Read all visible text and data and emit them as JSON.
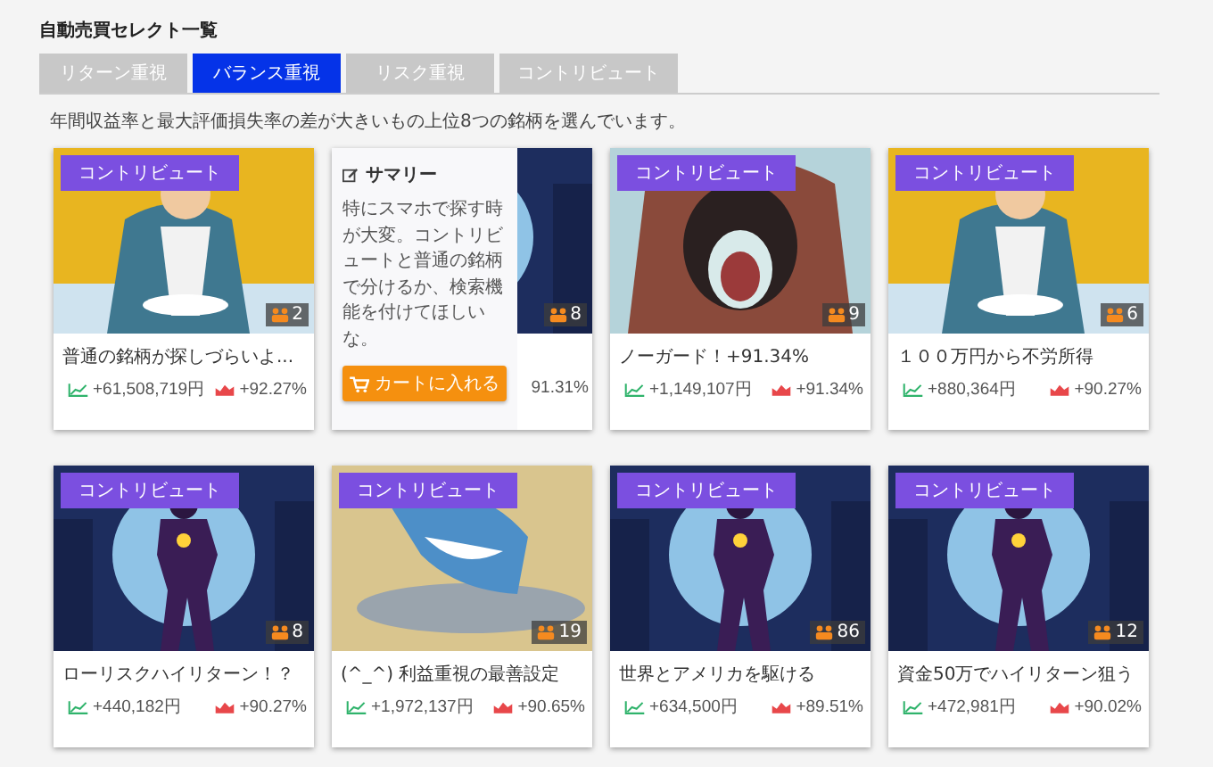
{
  "page_title": "自動売買セレクト一覧",
  "tabs": [
    {
      "label": "リターン重視",
      "selected": false
    },
    {
      "label": "バランス重視",
      "selected": true
    },
    {
      "label": "リスク重視",
      "selected": false
    },
    {
      "label": "コントリビュート",
      "selected": false
    }
  ],
  "description": "年間収益率と最大評価損失率の差が大きいもの上位8つの銘柄を選んでいます。",
  "cards": [
    {
      "kind": "diner",
      "badge": "コントリビュート",
      "count": "2",
      "title": "普通の銘柄が探しづらいよ...",
      "profit": "+61,508,719円",
      "rate": "+92.27%"
    },
    {
      "kind": "hero",
      "count": "8",
      "rate": "91.31%",
      "popup": {
        "heading": "サマリー",
        "text": "特にスマホで探す時が大変。コントリビュートと普通の銘柄で分けるか、検索機能を付けてほしいな。",
        "button": "カートに入れる"
      }
    },
    {
      "kind": "gorilla",
      "badge": "コントリビュート",
      "count": "9",
      "title": "ノーガード！+91.34%",
      "profit": "+1,149,107円",
      "rate": "+91.34%"
    },
    {
      "kind": "diner",
      "badge": "コントリビュート",
      "count": "6",
      "title": "１００万円から不労所得",
      "profit": "+880,364円",
      "rate": "+90.27%"
    },
    {
      "kind": "hero",
      "badge": "コントリビュート",
      "count": "8",
      "title": "ローリスクハイリターン！？",
      "profit": "+440,182円",
      "rate": "+90.27%"
    },
    {
      "kind": "shark",
      "badge": "コントリビュート",
      "count": "19",
      "title": "(^_^) 利益重視の最善設定",
      "profit": "+1,972,137円",
      "rate": "+90.65%"
    },
    {
      "kind": "hero",
      "badge": "コントリビュート",
      "count": "86",
      "title": "世界とアメリカを駆ける",
      "profit": "+634,500円",
      "rate": "+89.51%"
    },
    {
      "kind": "hero",
      "badge": "コントリビュート",
      "count": "12",
      "title": "資金50万でハイリターン狙う",
      "profit": "+472,981円",
      "rate": "+90.02%"
    }
  ]
}
